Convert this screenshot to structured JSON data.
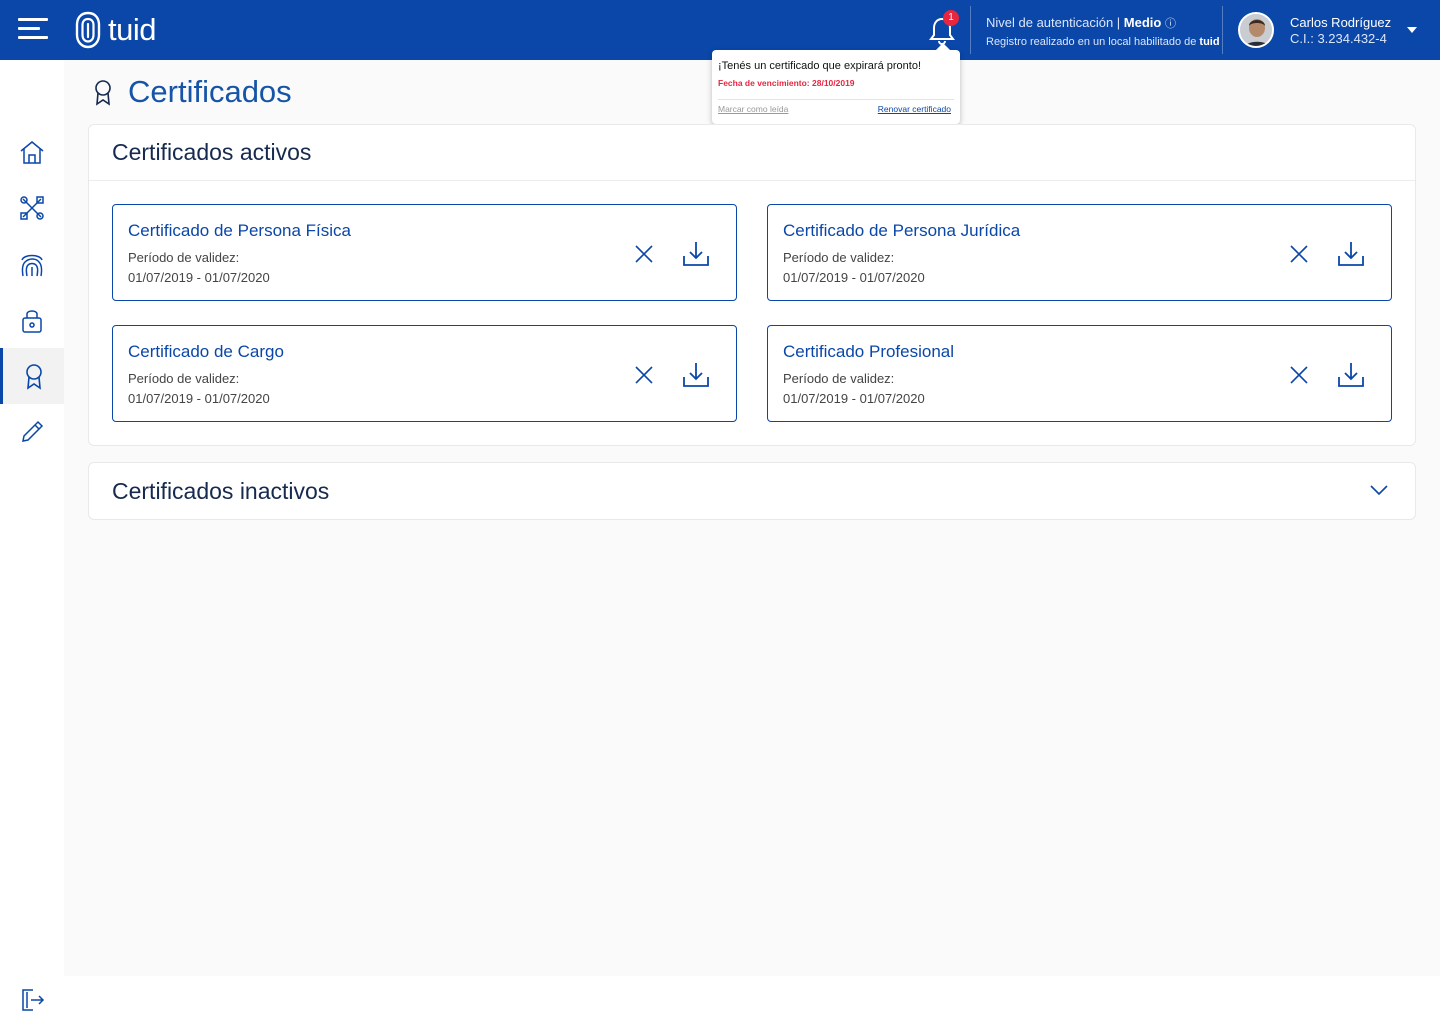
{
  "brand": {
    "logo_text": "tuid"
  },
  "header": {
    "notification_count": "1",
    "auth_label": "Nivel de autenticación | ",
    "auth_level": "Medio",
    "auth_info_icon": "ⓘ",
    "registration_text": "Registro realizado en un local habilitado de ",
    "registration_brand": "tuid",
    "user_name": "Carlos Rodríguez",
    "user_ci": "C.I.: 3.234.432-4"
  },
  "notification": {
    "message": "¡Tenés un certificado que expirará pronto!",
    "expiry": "Fecha de vencimiento: 28/10/2019",
    "mark_read": "Marcar como leída",
    "renew": "Renovar certificado"
  },
  "sidebar": {
    "items": [
      {
        "name": "home",
        "icon": "home-icon"
      },
      {
        "name": "tools",
        "icon": "tools-icon"
      },
      {
        "name": "fingerprint",
        "icon": "fingerprint-icon"
      },
      {
        "name": "security",
        "icon": "lock-icon"
      },
      {
        "name": "certificates",
        "icon": "award-icon",
        "active": true
      },
      {
        "name": "signature",
        "icon": "pen-icon"
      }
    ],
    "logout_icon": "logout-icon"
  },
  "page": {
    "title": "Certificados"
  },
  "active_certs": {
    "title": "Certificados activos",
    "cards": [
      {
        "title": "Certificado de Persona Física",
        "label": "Período de validez:",
        "dates": "01/07/2019 - 01/07/2020"
      },
      {
        "title": "Certificado de Persona Jurídica",
        "label": "Período de validez:",
        "dates": "01/07/2019 - 01/07/2020"
      },
      {
        "title": "Certificado de Cargo",
        "label": "Período de validez:",
        "dates": "01/07/2019 - 01/07/2020"
      },
      {
        "title": "Certificado Profesional",
        "label": "Período de validez:",
        "dates": "01/07/2019 - 01/07/2020"
      }
    ]
  },
  "inactive_certs": {
    "title": "Certificados inactivos"
  },
  "colors": {
    "primary": "#0a47a9",
    "alert": "#e8263f",
    "background": "#fafafa"
  }
}
